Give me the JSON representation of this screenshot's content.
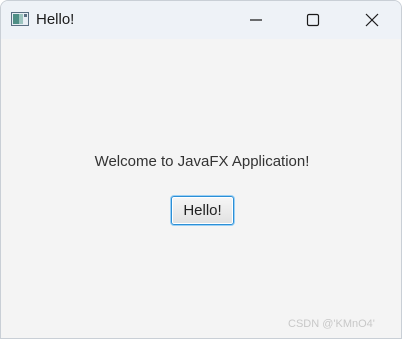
{
  "window": {
    "title": "Hello!",
    "controls": {
      "minimize_icon": "minimize-icon",
      "maximize_icon": "maximize-icon",
      "close_icon": "close-icon"
    }
  },
  "content": {
    "welcome_text": "Welcome to JavaFX Application!",
    "button_label": "Hello!"
  },
  "watermark": "CSDN @'KMnO4'",
  "colors": {
    "titlebar": "#eef2f7",
    "background": "#f4f4f4",
    "button_focus": "#2c8fd6"
  }
}
